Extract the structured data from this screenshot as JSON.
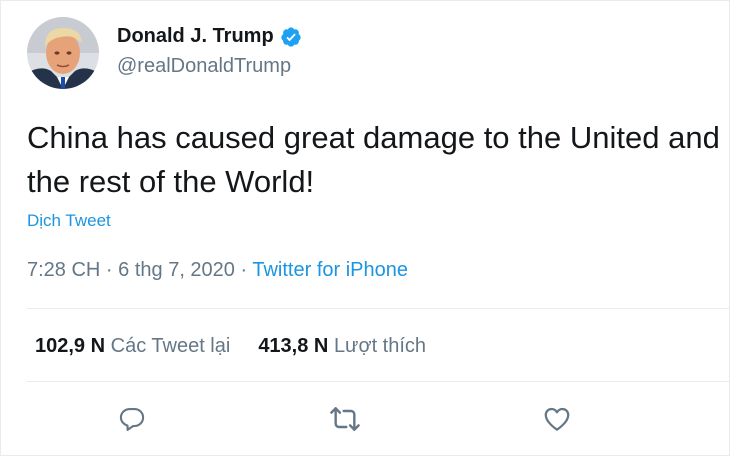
{
  "author": {
    "display_name": "Donald J. Trump",
    "handle": "@realDonaldTrump",
    "verified": true,
    "verified_badge_icon": "verified-badge-icon",
    "avatar": "profile-photo"
  },
  "tweet": {
    "text": "China has caused great damage to the United and the rest of the World!",
    "translate_label": "Dịch Tweet"
  },
  "meta": {
    "time": "7:28 CH",
    "separator1": " · ",
    "date": "6 thg 7, 2020",
    "separator2": " · ",
    "source": "Twitter for iPhone"
  },
  "stats": {
    "retweets_count": "102,9 N",
    "retweets_label": "Các Tweet lại",
    "likes_count": "413,8 N",
    "likes_label": "Lượt thích"
  },
  "actions": {
    "reply_icon": "reply-icon",
    "retweet_icon": "retweet-icon",
    "like_icon": "heart-icon"
  },
  "colors": {
    "link": "#1b95e0",
    "secondary_text": "#657786",
    "primary_text": "#14171a",
    "divider": "#e6ecf0"
  }
}
